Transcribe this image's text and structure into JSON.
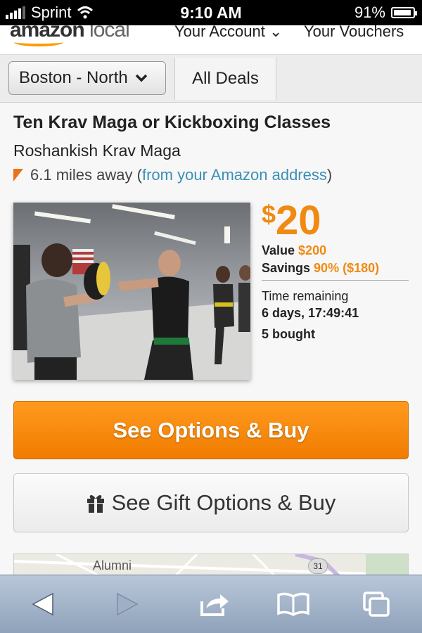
{
  "status_bar": {
    "carrier": "Sprint",
    "time": "9:10 AM",
    "battery": "91%"
  },
  "site_header": {
    "logo_text": "amazon",
    "logo_suffix": "local",
    "account_label": "Your Account",
    "vouchers_label": "Your Vouchers"
  },
  "nav": {
    "city": "Boston - North",
    "all_deals": "All Deals"
  },
  "deal": {
    "title": "Ten Krav Maga or Kickboxing Classes",
    "merchant": "Roshankish Krav Maga",
    "distance": "6.1 miles away",
    "distance_open": " (",
    "distance_link": "from your Amazon address",
    "distance_close": ")",
    "price_symbol": "$",
    "price_amount": "20",
    "value_label": "Value",
    "value_amount": "$200",
    "savings_label": "Savings",
    "savings_amount": "90% ($180)",
    "time_remaining_label": "Time remaining",
    "time_remaining_value": "6 days, 17:49:41",
    "bought": "5 bought"
  },
  "buttons": {
    "buy": "See Options & Buy",
    "gift": "See Gift Options & Buy"
  },
  "map": {
    "label": "Alumni",
    "route": "31"
  },
  "colors": {
    "accent": "#f08a12",
    "link": "#3b8fb5"
  },
  "icons": [
    "signal-icon",
    "wifi-icon",
    "battery-icon",
    "location-pin-icon",
    "chevron-down-icon",
    "gift-icon",
    "back-icon",
    "forward-icon",
    "share-icon",
    "bookmarks-icon",
    "tabs-icon"
  ]
}
